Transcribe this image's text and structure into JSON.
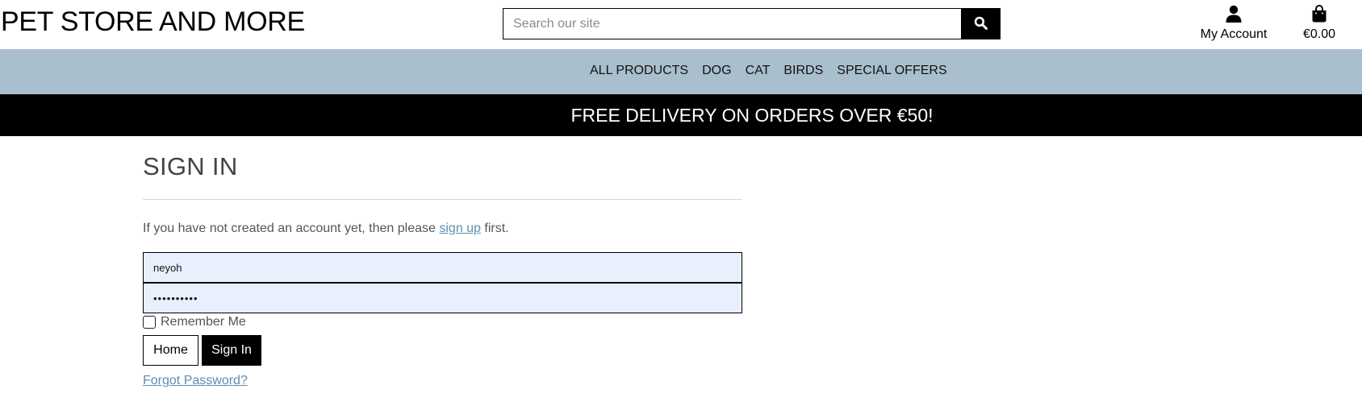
{
  "header": {
    "logo": "PET STORE AND MORE",
    "search_placeholder": "Search our site",
    "account_label": "My Account",
    "cart_total": "€0.00"
  },
  "nav": {
    "items": [
      "ALL PRODUCTS",
      "DOG",
      "CAT",
      "BIRDS",
      "SPECIAL OFFERS"
    ]
  },
  "banner": {
    "text": "FREE DELIVERY ON ORDERS OVER €50!"
  },
  "signin": {
    "title": "SIGN IN",
    "intro_before": "If you have not created an account yet, then please ",
    "intro_link": "sign up",
    "intro_after": " first.",
    "username_value": "neyoh",
    "password_value": "••••••••••",
    "remember_label": "Remember Me",
    "remember_checked": false,
    "home_button": "Home",
    "signin_button": "Sign In",
    "forgot_link": "Forgot Password?"
  },
  "icons": {
    "search": "search-icon",
    "account": "user-icon",
    "cart": "shopping-bag-icon"
  },
  "colors": {
    "nav_bg": "#aabfce",
    "banner_bg": "#000000",
    "link": "#5c8fb0",
    "autofill_bg": "#e8f0fe"
  }
}
